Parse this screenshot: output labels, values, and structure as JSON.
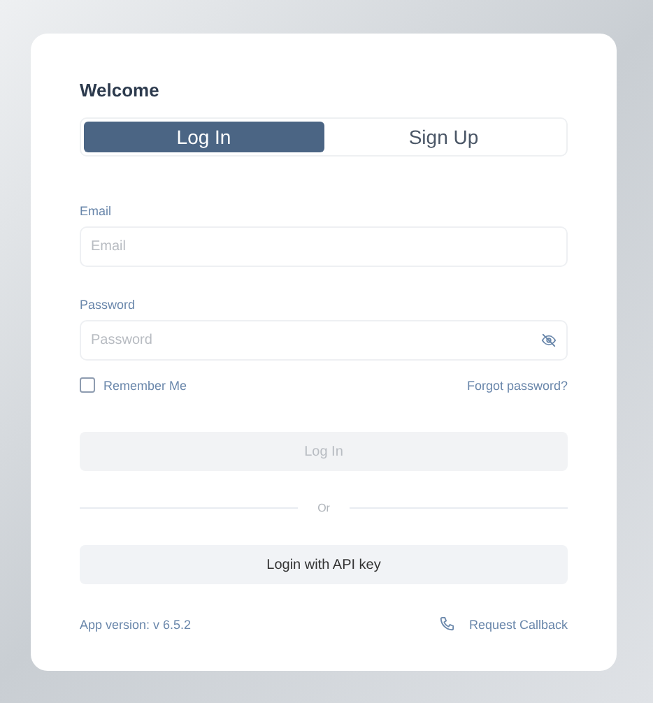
{
  "title": "Welcome",
  "tabs": [
    {
      "label": "Log In",
      "selected": true
    },
    {
      "label": "Sign Up",
      "selected": false
    }
  ],
  "email": {
    "label": "Email",
    "placeholder": "Email"
  },
  "password": {
    "label": "Password",
    "placeholder": "Password"
  },
  "remember": {
    "label": "Remember Me",
    "checked": false
  },
  "forgot_link": "Forgot password?",
  "login_button": {
    "label": "Log In",
    "disabled": true
  },
  "divider_text": "Or",
  "api_button": "Login with API key",
  "version": "App version: v 6.5.2",
  "callback_link": "Request Callback"
}
